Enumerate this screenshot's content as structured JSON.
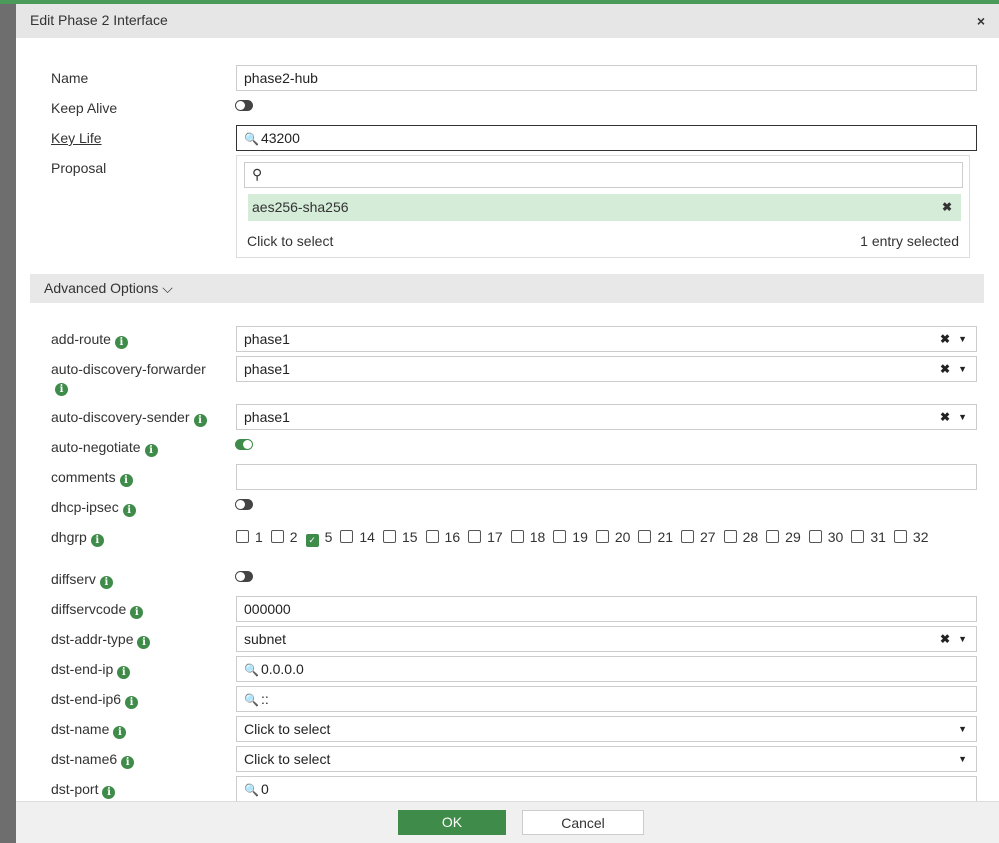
{
  "dialog": {
    "title": "Edit Phase 2 Interface",
    "close": "×"
  },
  "form": {
    "name_label": "Name",
    "name_value": "phase2-hub",
    "keepalive_label": "Keep Alive",
    "keepalive_on": false,
    "keylife_label": "Key Life",
    "keylife_value": "43200",
    "proposal_label": "Proposal",
    "proposal_search_placeholder": "",
    "proposal_selected": "aes256-sha256",
    "proposal_hint": "Click to select",
    "proposal_count": "1 entry selected"
  },
  "advanced": {
    "label": "Advanced Options",
    "rows": [
      {
        "label": "add-route",
        "type": "select",
        "value": "phase1",
        "clear": true
      },
      {
        "label": "auto-discovery-forwarder",
        "type": "select",
        "value": "phase1",
        "clear": true
      },
      {
        "label": "auto-discovery-sender",
        "type": "select",
        "value": "phase1",
        "clear": true
      },
      {
        "label": "auto-negotiate",
        "type": "toggle",
        "on": true
      },
      {
        "label": "comments",
        "type": "text",
        "value": ""
      },
      {
        "label": "dhcp-ipsec",
        "type": "toggle",
        "on": false
      },
      {
        "label": "dhgrp",
        "type": "checks",
        "options": [
          "1",
          "2",
          "5",
          "14",
          "15",
          "16",
          "17",
          "18",
          "19",
          "20",
          "21",
          "27",
          "28",
          "29",
          "30",
          "31",
          "32"
        ],
        "checked": [
          "5"
        ]
      },
      {
        "label": "diffserv",
        "type": "toggle",
        "on": false
      },
      {
        "label": "diffservcode",
        "type": "text",
        "value": "000000"
      },
      {
        "label": "dst-addr-type",
        "type": "select",
        "value": "subnet",
        "clear": true
      },
      {
        "label": "dst-end-ip",
        "type": "search",
        "value": "0.0.0.0"
      },
      {
        "label": "dst-end-ip6",
        "type": "search",
        "value": "::"
      },
      {
        "label": "dst-name",
        "type": "select",
        "value": "Click to select",
        "clear": false
      },
      {
        "label": "dst-name6",
        "type": "select",
        "value": "Click to select",
        "clear": false
      },
      {
        "label": "dst-port",
        "type": "search",
        "value": "0"
      }
    ]
  },
  "footer": {
    "ok": "OK",
    "cancel": "Cancel"
  }
}
